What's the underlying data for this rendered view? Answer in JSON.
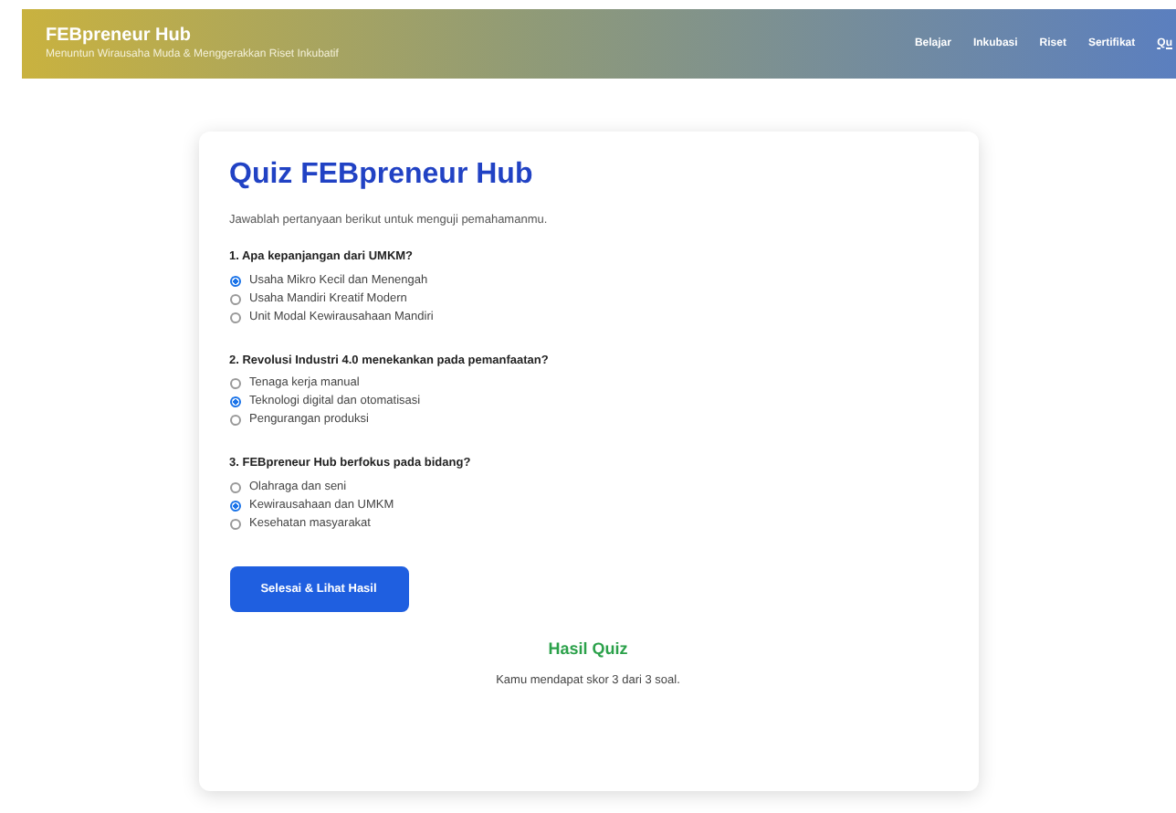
{
  "header": {
    "title": "FEBpreneur Hub",
    "subtitle": "Menuntun Wirausaha Muda & Menggerakkan Riset Inkubatif"
  },
  "nav": [
    {
      "label": "Belajar",
      "selected": false
    },
    {
      "label": "Inkubasi",
      "selected": false
    },
    {
      "label": "Riset",
      "selected": false
    },
    {
      "label": "Sertifikat",
      "selected": false
    },
    {
      "label": "Qu",
      "selected": true
    }
  ],
  "quiz": {
    "title": "Quiz FEBpreneur Hub",
    "intro": "Jawablah pertanyaan berikut untuk menguji pemahamanmu.",
    "questions": [
      {
        "question": "1. Apa kepanjangan dari UMKM?",
        "options": [
          {
            "label": "Usaha Mikro Kecil dan Menengah",
            "selected": true
          },
          {
            "label": "Usaha Mandiri Kreatif Modern",
            "selected": false
          },
          {
            "label": "Unit Modal Kewirausahaan Mandiri",
            "selected": false
          }
        ]
      },
      {
        "question": "2. Revolusi Industri 4.0 menekankan pada pemanfaatan?",
        "options": [
          {
            "label": "Tenaga kerja manual",
            "selected": false
          },
          {
            "label": "Teknologi digital dan otomatisasi",
            "selected": true
          },
          {
            "label": "Pengurangan produksi",
            "selected": false
          }
        ]
      },
      {
        "question": "3. FEBpreneur Hub berfokus pada bidang?",
        "options": [
          {
            "label": "Olahraga dan seni",
            "selected": false
          },
          {
            "label": "Kewirausahaan dan UMKM",
            "selected": true
          },
          {
            "label": "Kesehatan masyarakat",
            "selected": false
          }
        ]
      }
    ],
    "submit": "Selesai & Lihat Hasil",
    "result": {
      "title": "Hasil Quiz",
      "text": "Kamu mendapat skor 3 dari 3 soal."
    }
  }
}
